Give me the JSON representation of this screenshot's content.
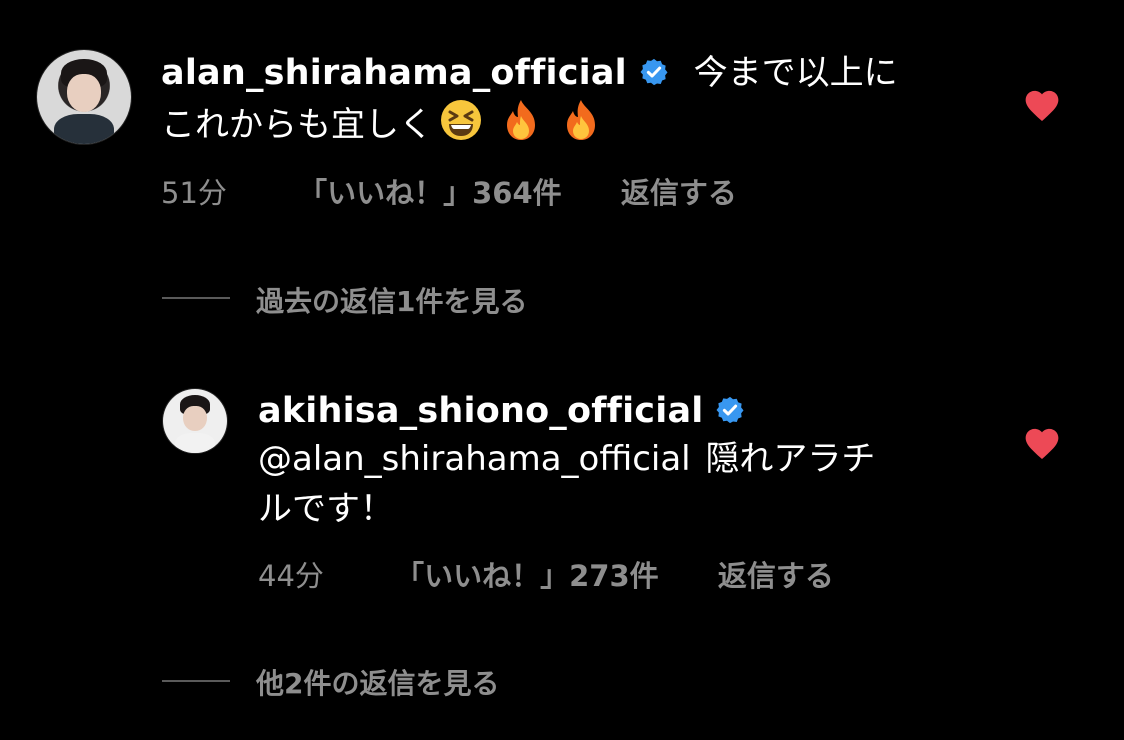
{
  "comment1": {
    "username": "alan_shirahama_official",
    "text_line1": "今まで以上に",
    "text_line2": "これからも宜しく",
    "time": "51分",
    "likes": "「いいね！」364件",
    "reply": "返信する"
  },
  "view_previous": "過去の返信1件を見る",
  "comment2": {
    "username": "akihisa_shiono_official",
    "mention": "@alan_shirahama_official",
    "text_line1_rest": "隠れアラチ",
    "text_line2": "ルです！",
    "time": "44分",
    "likes": "「いいね！」273件",
    "reply": "返信する"
  },
  "view_more": "他2件の返信を見る",
  "colors": {
    "background": "#000000",
    "verified": "#3897f0",
    "heart": "#ed4956",
    "muted_text": "#8e8e8e"
  },
  "icons": [
    "verified-badge-icon",
    "heart-icon",
    "grinning-squinting-emoji-icon",
    "fire-emoji-icon"
  ]
}
